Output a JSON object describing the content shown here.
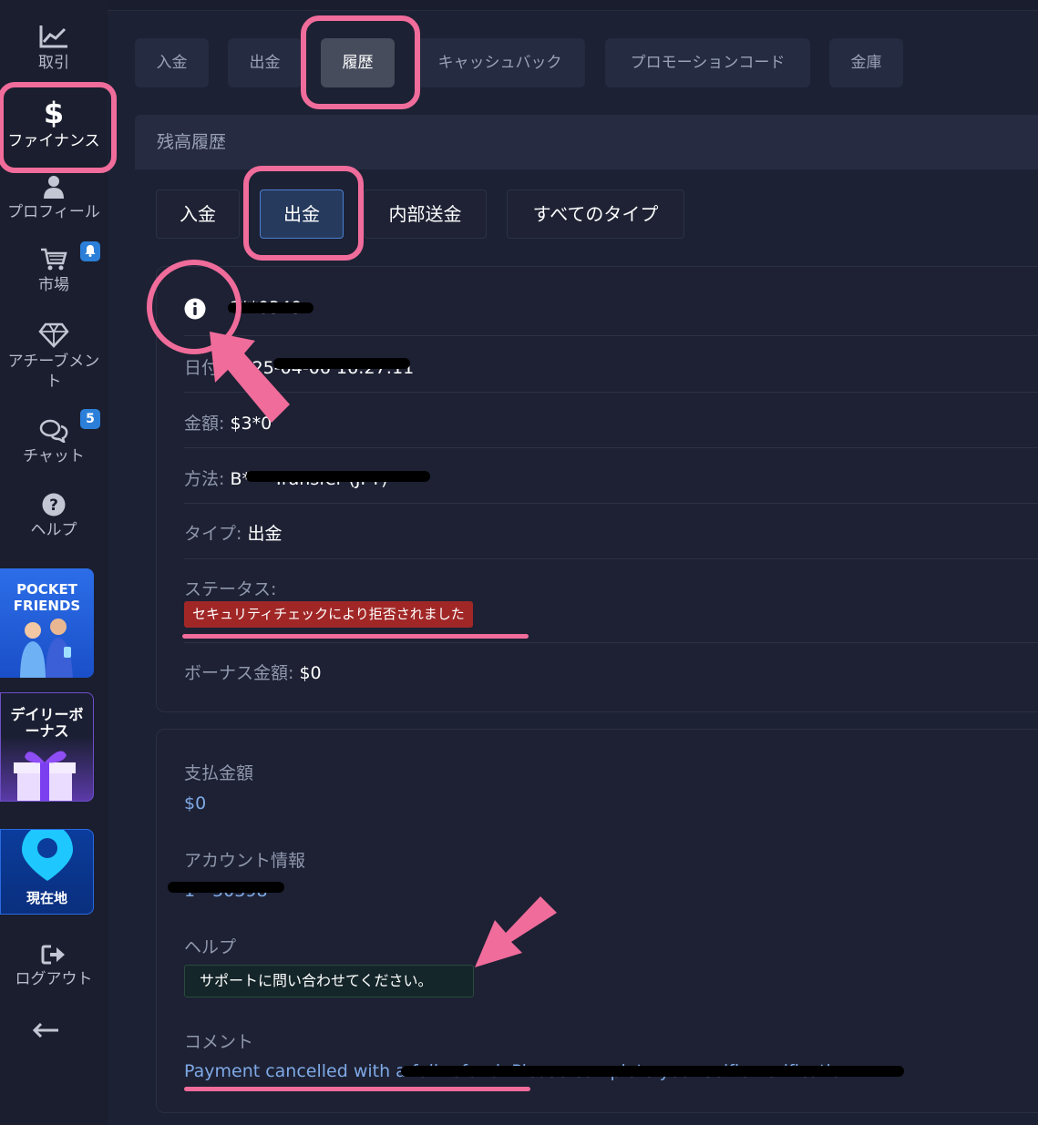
{
  "sidebar": {
    "items": [
      {
        "label": "取引",
        "icon": "chart-line-icon"
      },
      {
        "label": "ファイナンス",
        "icon": "dollar-icon"
      },
      {
        "label": "プロフィール",
        "icon": "user-icon"
      },
      {
        "label": "市場",
        "icon": "cart-icon",
        "badge_icon": "bell-icon"
      },
      {
        "label": "アチーブメン",
        "label2": "ト",
        "icon": "diamond-icon"
      },
      {
        "label": "チャット",
        "icon": "chat-icon",
        "badge": "5"
      },
      {
        "label": "ヘルプ",
        "icon": "question-icon"
      },
      {
        "label": "ログアウト",
        "icon": "logout-icon"
      }
    ],
    "promos": {
      "pocket_line1": "POCKET",
      "pocket_line2": "FRIENDS",
      "daily_line1": "デイリーボ",
      "daily_line2": "ーナス",
      "location": "現在地"
    }
  },
  "tabs": [
    "入金",
    "出金",
    "履歴",
    "キャッシュバック",
    "プロモーションコード",
    "金庫"
  ],
  "section_title": "残高履歴",
  "filters": [
    "入金",
    "出金",
    "内部送金",
    "すべてのタイプ"
  ],
  "details": {
    "id_value": "1**0349",
    "date_label": "日付:",
    "date_value": "2025-04-06 16:27:11",
    "amount_label": "金額:",
    "amount_value": "$3*0",
    "method_label": "方法:",
    "method_value": "B*** Transfer (JPY)",
    "type_label": "タイプ:",
    "type_value": "出金",
    "status_label": "ステータス:",
    "status_value": "セキュリティチェックにより拒否されました",
    "bonus_label": "ボーナス金額:",
    "bonus_value": "$0"
  },
  "payout": {
    "paid_label": "支払金額",
    "paid_value": "$0",
    "account_label": "アカウント情報",
    "account_value": "1**50398",
    "help_label": "ヘルプ",
    "help_value": "サポートに問い合わせてください。",
    "comment_label": "コメント",
    "comment_value": "Payment cancelled with a full refund. Please complete your selfie verification."
  },
  "colors": {
    "annotation": "#f06c9b",
    "status_rejected": "#a12727",
    "accent_blue": "#2b7fd8"
  }
}
